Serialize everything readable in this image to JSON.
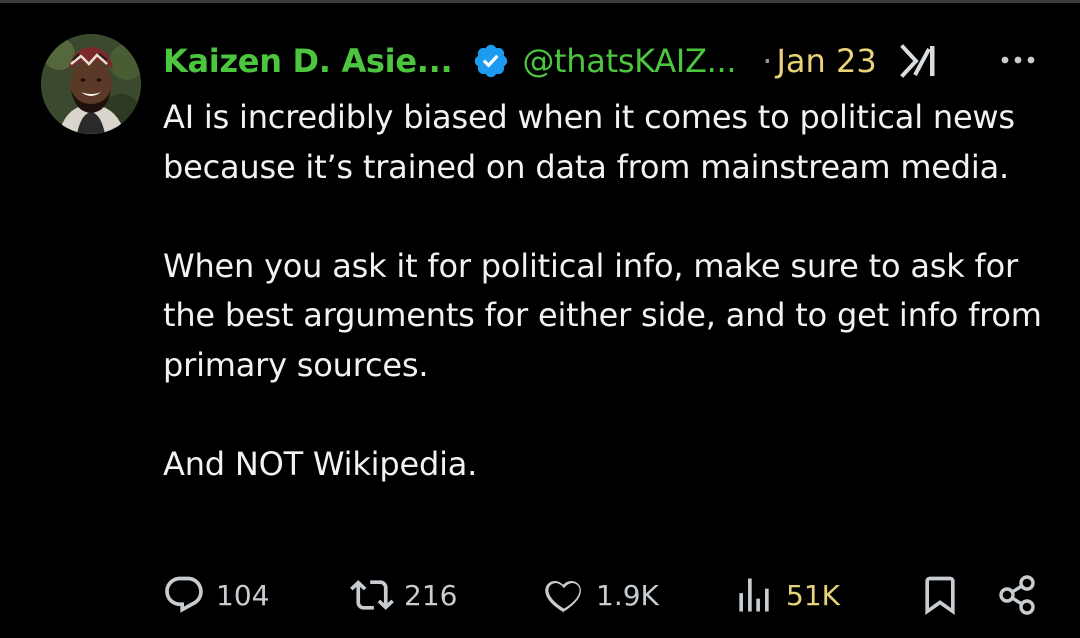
{
  "post": {
    "author": {
      "name": "Kaizen D. Asie...",
      "handle": "@thatsKAIZ...",
      "verified": true
    },
    "separator": "·",
    "date": "Jan 23",
    "text": [
      "AI is incredibly biased when it comes to political news because it’s trained on data from mainstream media.",
      "When you ask it for political info, make sure to ask for the best arguments for either side, and to get info from primary sources.",
      "And NOT Wikipedia."
    ],
    "metrics": {
      "replies": "104",
      "reposts": "216",
      "likes": "1.9K",
      "views": "51K"
    },
    "icons": {
      "verified": "verified-badge-icon",
      "source": "xai-grok-icon",
      "more": "more-icon",
      "reply": "reply-icon",
      "repost": "repost-icon",
      "like": "heart-icon",
      "views": "views-chart-icon",
      "bookmark": "bookmark-icon",
      "share": "share-icon"
    },
    "colors": {
      "background": "#000000",
      "name_handle": "#4cc53f",
      "date_and_views": "#e9d37a",
      "text": "#f2f2f2",
      "verified_badge": "#1d9bf0",
      "secondary": "#8b98a5"
    }
  }
}
